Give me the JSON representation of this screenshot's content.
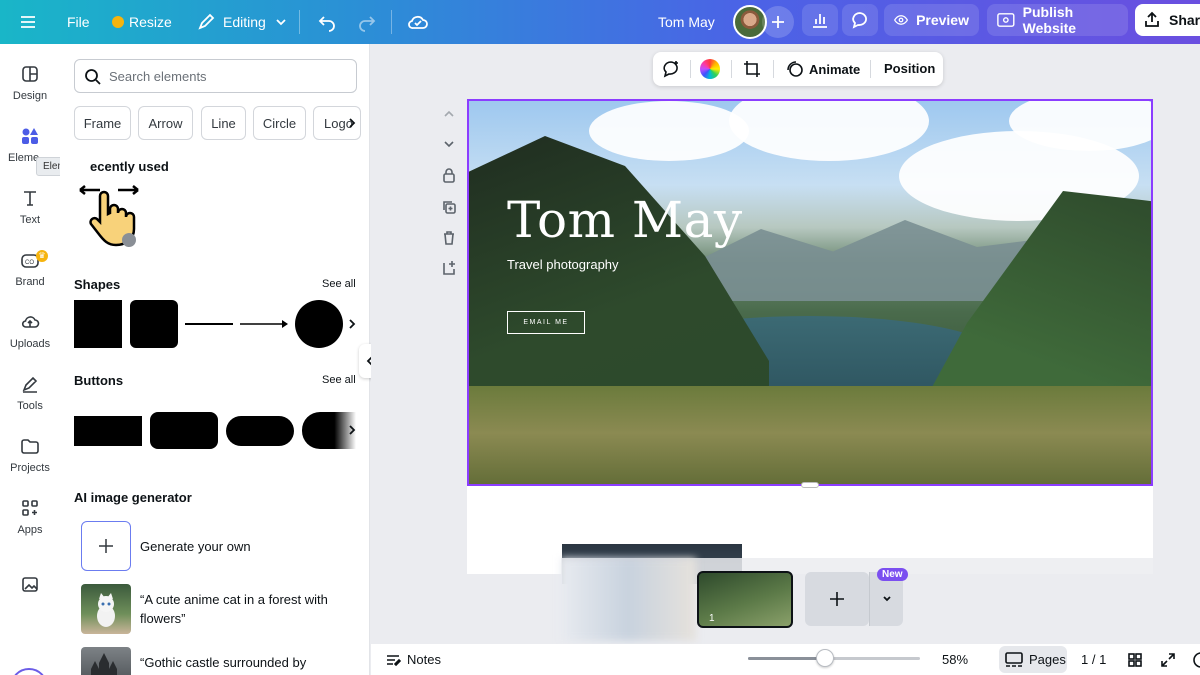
{
  "topbar": {
    "file": "File",
    "resize": "Resize",
    "editing": "Editing",
    "doc_title": "Tom May",
    "preview": "Preview",
    "publish": "Publish Website",
    "share": "Share"
  },
  "rail": {
    "items": [
      {
        "label": "Design",
        "icon": "layout-icon"
      },
      {
        "label": "Eleme",
        "icon": "elements-icon"
      },
      {
        "label": "Text",
        "icon": "text-icon"
      },
      {
        "label": "Brand",
        "icon": "brand-icon"
      },
      {
        "label": "Uploads",
        "icon": "upload-cloud-icon"
      },
      {
        "label": "Tools",
        "icon": "pen-tool-icon"
      },
      {
        "label": "Projects",
        "icon": "folder-icon"
      },
      {
        "label": "Apps",
        "icon": "apps-icon"
      }
    ],
    "tooltip": "Elements",
    "accent": "#4c5ce6"
  },
  "panel": {
    "search_placeholder": "Search elements",
    "chips": [
      "Frame",
      "Arrow",
      "Line",
      "Circle",
      "Logo"
    ],
    "recently_used": "ecently used",
    "shapes_title": "Shapes",
    "buttons_title": "Buttons",
    "see_all": "See all",
    "ai_title": "AI image generator",
    "generate": "Generate your own",
    "prompts": [
      "“A cute anime cat in a forest with flowers”",
      "“Gothic castle surrounded by"
    ]
  },
  "canvas": {
    "toolbar": {
      "animate": "Animate",
      "position": "Position"
    },
    "hero": {
      "title": "Tom May",
      "subtitle": "Travel photography",
      "button": "EMAIL ME"
    },
    "selection_color": "#8b3dff",
    "page_strip": {
      "page_number": "1",
      "new_badge": "New"
    }
  },
  "bottombar": {
    "notes": "Notes",
    "zoom": "58%",
    "zoom_value": 0.58,
    "pages": "Pages",
    "page_count": "1 / 1"
  }
}
